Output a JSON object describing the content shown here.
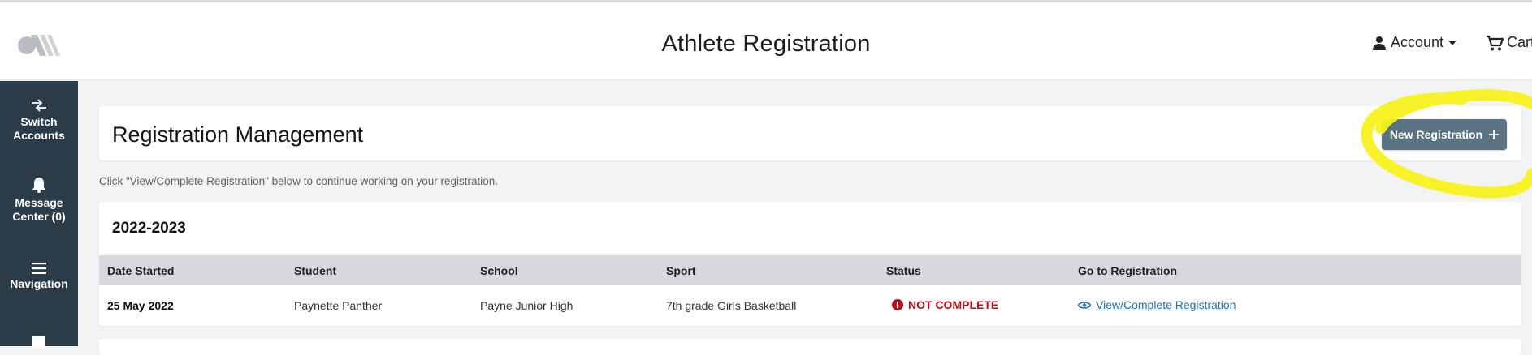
{
  "header": {
    "title": "Athlete Registration",
    "account_label": "Account",
    "cart_label": "Cart"
  },
  "sidebar": {
    "items": [
      {
        "label": "Switch Accounts",
        "icon": "switch-arrows-icon"
      },
      {
        "label": "Message Center (0)",
        "icon": "bell-icon"
      },
      {
        "label": "Navigation",
        "icon": "hamburger-menu-icon"
      },
      {
        "label": "",
        "icon": "document-icon"
      }
    ]
  },
  "main": {
    "page_title": "Registration Management",
    "new_registration_label": "New Registration",
    "hint": "Click \"View/Complete Registration\" below to continue working on your registration.",
    "season": {
      "year": "2022-2023",
      "columns": [
        "Date Started",
        "Student",
        "School",
        "Sport",
        "Status",
        "Go to Registration"
      ],
      "rows": [
        {
          "date_started": "25 May 2022",
          "student": "Paynette Panther",
          "school": "Payne Junior High",
          "sport": "7th grade Girls Basketball",
          "status": "NOT COMPLETE",
          "action": "View/Complete Registration"
        }
      ]
    }
  },
  "colors": {
    "sidebar_bg": "#2b3b48",
    "button_bg": "#5b7283",
    "status_red": "#b3131a",
    "link_blue": "#2b6ea8",
    "highlight_yellow": "#f7f21c",
    "table_header_bg": "#d6d8dc"
  }
}
